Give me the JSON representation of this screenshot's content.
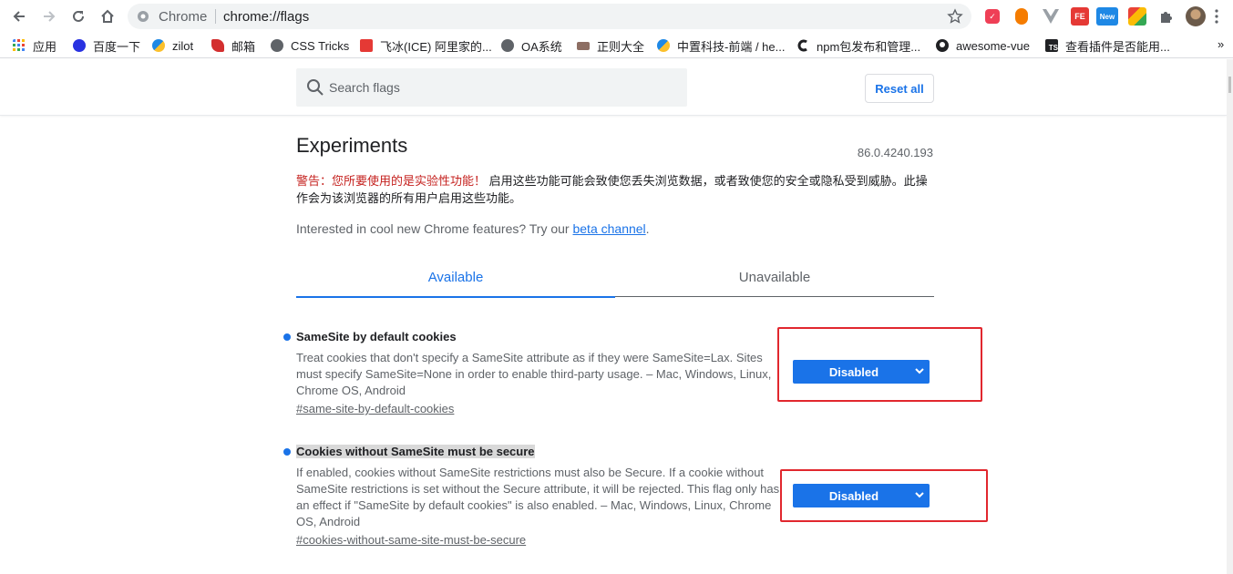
{
  "omnibox": {
    "site_label": "Chrome",
    "url": "chrome://flags"
  },
  "bookmarks": [
    {
      "label": "应用",
      "icon": "apps-grid-icon",
      "color": "#4285f4"
    },
    {
      "label": "百度一下",
      "icon": "baidu-icon",
      "color": "#2932e1"
    },
    {
      "label": "zilot",
      "icon": "zilot-icon",
      "color": "#1e88e5"
    },
    {
      "label": "邮箱",
      "icon": "mail-bird-icon",
      "color": "#d32f2f"
    },
    {
      "label": "CSS Tricks",
      "icon": "globe-icon",
      "color": "#5f6368"
    },
    {
      "label": "飞冰(ICE) 阿里家的...",
      "icon": "ice-icon",
      "color": "#e53935"
    },
    {
      "label": "OA系统",
      "icon": "globe-icon",
      "color": "#5f6368"
    },
    {
      "label": "正则大全",
      "icon": "regex-icon",
      "color": "#8d6e63"
    },
    {
      "label": "中置科技-前端 / he...",
      "icon": "company-icon",
      "color": "#1e88e5"
    },
    {
      "label": "npm包发布和管理...",
      "icon": "c-logo-icon",
      "color": "#202124"
    },
    {
      "label": "awesome-vue",
      "icon": "github-icon",
      "color": "#202124"
    },
    {
      "label": "查看插件是否能用...",
      "icon": "ts-icon",
      "color": "#202124"
    }
  ],
  "search": {
    "placeholder": "Search flags"
  },
  "reset_label": "Reset all",
  "page": {
    "title": "Experiments",
    "version": "86.0.4240.193",
    "warning_prefix": "警告：您所要使用的是实验性功能！",
    "warning_text": " 启用这些功能可能会致使您丢失浏览数据，或者致使您的安全或隐私受到威胁。此操作会为该浏览器的所有用户启用这些功能。",
    "intro_text": "Interested in cool new Chrome features? Try our ",
    "intro_link": "beta channel",
    "intro_end": "."
  },
  "tabs": {
    "available": "Available",
    "unavailable": "Unavailable"
  },
  "flags": [
    {
      "name": "SameSite by default cookies",
      "description": "Treat cookies that don't specify a SameSite attribute as if they were SameSite=Lax. Sites must specify SameSite=None in order to enable third-party usage. – Mac, Windows, Linux, Chrome OS, Android",
      "link": "#same-site-by-default-cookies",
      "value": "Disabled"
    },
    {
      "name": "Cookies without SameSite must be secure",
      "description": "If enabled, cookies without SameSite restrictions must also be Secure. If a cookie without SameSite restrictions is set without the Secure attribute, it will be rejected. This flag only has an effect if \"SameSite by default cookies\" is also enabled. – Mac, Windows, Linux, Chrome OS, Android",
      "link": "#cookies-without-same-site-must-be-secure",
      "value": "Disabled"
    }
  ],
  "colors": {
    "accent": "#1a73e8",
    "highlight_box": "#e1272e",
    "warning": "#c5221f"
  }
}
